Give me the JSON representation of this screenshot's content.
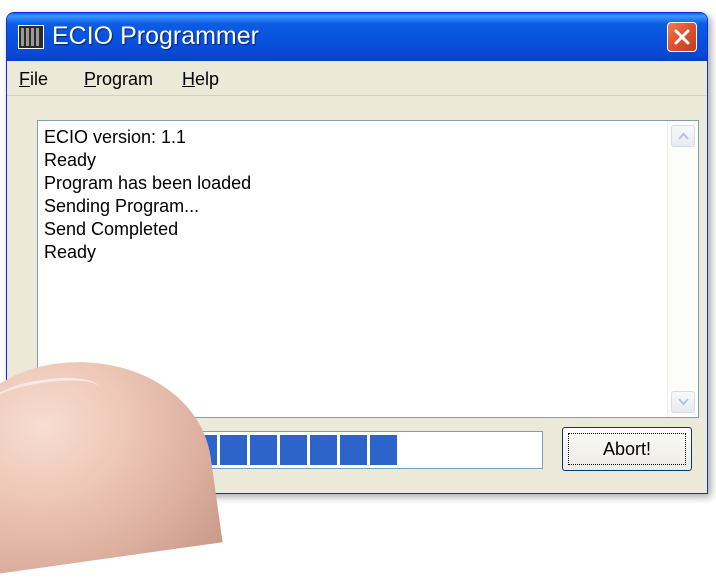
{
  "window": {
    "title": "ECIO Programmer",
    "icon": "ecio-app-icon",
    "close_icon": "close-icon"
  },
  "menu": [
    {
      "mnemonic": "F",
      "rest": "ile"
    },
    {
      "mnemonic": "P",
      "rest": "rogram"
    },
    {
      "mnemonic": "H",
      "rest": "elp"
    }
  ],
  "log": {
    "lines": [
      "ECIO version: 1.1",
      "Ready",
      "Program has been loaded",
      "Sending Program...",
      "Send Completed",
      "Ready"
    ]
  },
  "progress": {
    "fraction": 0.78,
    "color": "#2d64c9"
  },
  "buttons": {
    "abort_label": "Abort!"
  },
  "colors": {
    "titlebar": "#0752dd",
    "window_bg": "#ece9d8",
    "close_button": "#e1532f"
  }
}
